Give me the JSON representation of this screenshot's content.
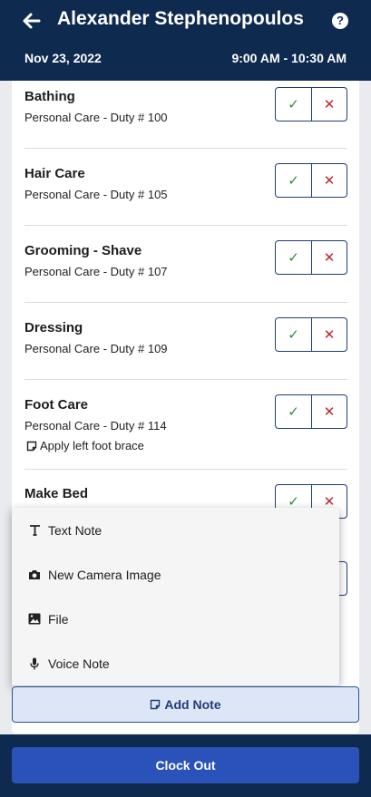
{
  "header": {
    "title": "Alexander Stephenopoulos",
    "date": "Nov 23, 2022",
    "time_range": "9:00 AM - 10:30 AM",
    "help_label": "?",
    "back_icon": "arrow-left-icon"
  },
  "duties": [
    {
      "name": "Bathing",
      "sub": "Personal Care - Duty # 100"
    },
    {
      "name": "Hair Care",
      "sub": "Personal Care - Duty # 105"
    },
    {
      "name": "Grooming - Shave",
      "sub": "Personal Care - Duty # 107"
    },
    {
      "name": "Dressing",
      "sub": "Personal Care - Duty # 109"
    },
    {
      "name": "Foot Care",
      "sub": "Personal Care - Duty # 114",
      "note": "Apply left foot brace"
    },
    {
      "name": "Make Bed"
    }
  ],
  "buttons": {
    "check": "✓",
    "cross": "✕"
  },
  "menu": {
    "items": [
      {
        "label": "Text Note",
        "icon": "text-icon"
      },
      {
        "label": "New Camera Image",
        "icon": "camera-icon"
      },
      {
        "label": "File",
        "icon": "image-file-icon"
      },
      {
        "label": "Voice Note",
        "icon": "microphone-icon"
      }
    ]
  },
  "add_note_label": "Add Note",
  "clock_out_label": "Clock Out",
  "colors": {
    "navy": "#0f2a4f",
    "primary": "#2a52b8",
    "success": "#2e8b3d",
    "danger": "#c0262d"
  }
}
